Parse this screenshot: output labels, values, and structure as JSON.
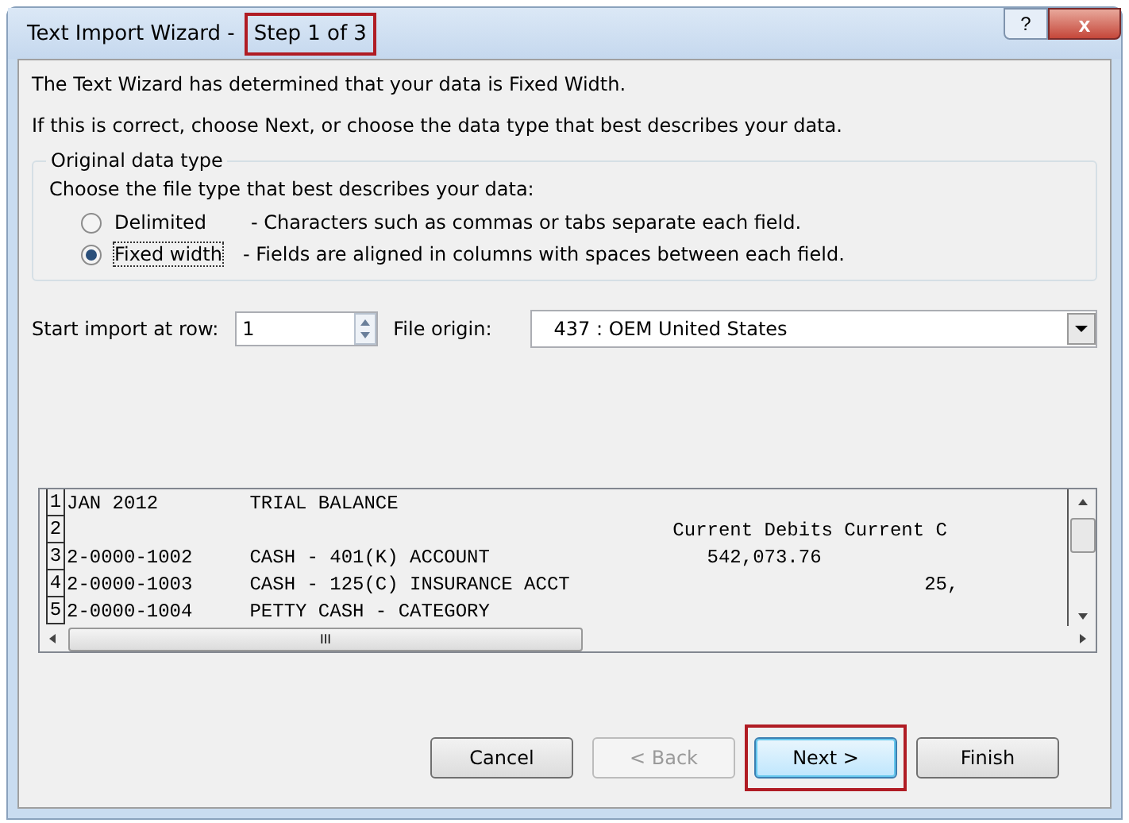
{
  "window": {
    "title_parts": [
      {
        "text": "Text Import Wizard -",
        "highlighted": false
      },
      {
        "text": "Step 1 of 3",
        "highlighted": true
      }
    ],
    "help_button": "?",
    "close_button": "x"
  },
  "intro": [
    "The Text Wizard has determined that your data is Fixed Width.",
    "If this is correct, choose Next, or choose the data type that best describes your data."
  ],
  "group": {
    "title": "Original data type",
    "prompt": "Choose the file type that best describes your data:",
    "options": [
      {
        "label": "Delimited",
        "description": "- Characters such as commas or tabs separate each field.",
        "selected": false
      },
      {
        "label": "Fixed width",
        "description": "- Fields are aligned in columns with spaces between each field.",
        "selected": true
      }
    ]
  },
  "start_row": {
    "label": "Start import at row:",
    "value": "1"
  },
  "file_origin": {
    "label": "File origin:",
    "value": "437 : OEM United States"
  },
  "preview": {
    "rows": [
      {
        "number": "1",
        "text": "JAN 2012        TRIAL BALANCE"
      },
      {
        "number": "2",
        "text": "                                                     Current Debits Current C"
      },
      {
        "number": "3",
        "text": "2-0000-1002     CASH - 401(K) ACCOUNT                   542,073.76"
      },
      {
        "number": "4",
        "text": "2-0000-1003     CASH - 125(C) INSURANCE ACCT                               25,"
      },
      {
        "number": "5",
        "text": "2-0000-1004     PETTY CASH - CATEGORY"
      }
    ],
    "scroll_grip": "III"
  },
  "buttons": [
    {
      "label": "Cancel",
      "disabled": false,
      "highlighted": false
    },
    {
      "label": "< Back",
      "disabled": true,
      "highlighted": false
    },
    {
      "label": "Next >",
      "disabled": false,
      "highlighted": true
    },
    {
      "label": "Finish",
      "disabled": false,
      "highlighted": false
    }
  ]
}
